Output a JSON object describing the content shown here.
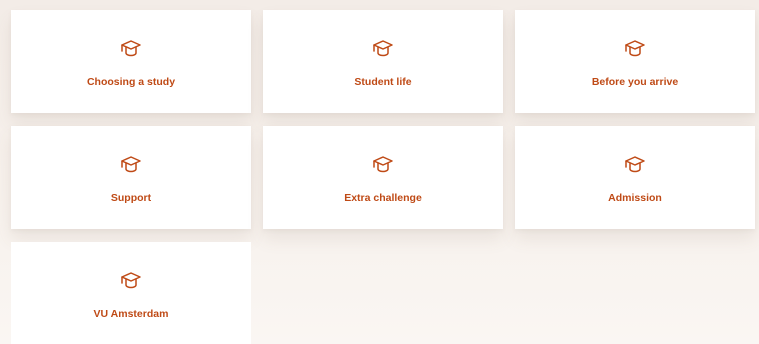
{
  "theme": {
    "accent": "#bf4a16",
    "tile_background": "#ffffff",
    "page_background": "#f6efe9"
  },
  "tiles": [
    {
      "label": "Choosing a study",
      "icon": "graduation-cap-icon"
    },
    {
      "label": "Student life",
      "icon": "graduation-cap-icon"
    },
    {
      "label": "Before you arrive",
      "icon": "graduation-cap-icon"
    },
    {
      "label": "Support",
      "icon": "graduation-cap-icon"
    },
    {
      "label": "Extra challenge",
      "icon": "graduation-cap-icon"
    },
    {
      "label": "Admission",
      "icon": "graduation-cap-icon"
    },
    {
      "label": "VU Amsterdam",
      "icon": "graduation-cap-icon"
    }
  ]
}
